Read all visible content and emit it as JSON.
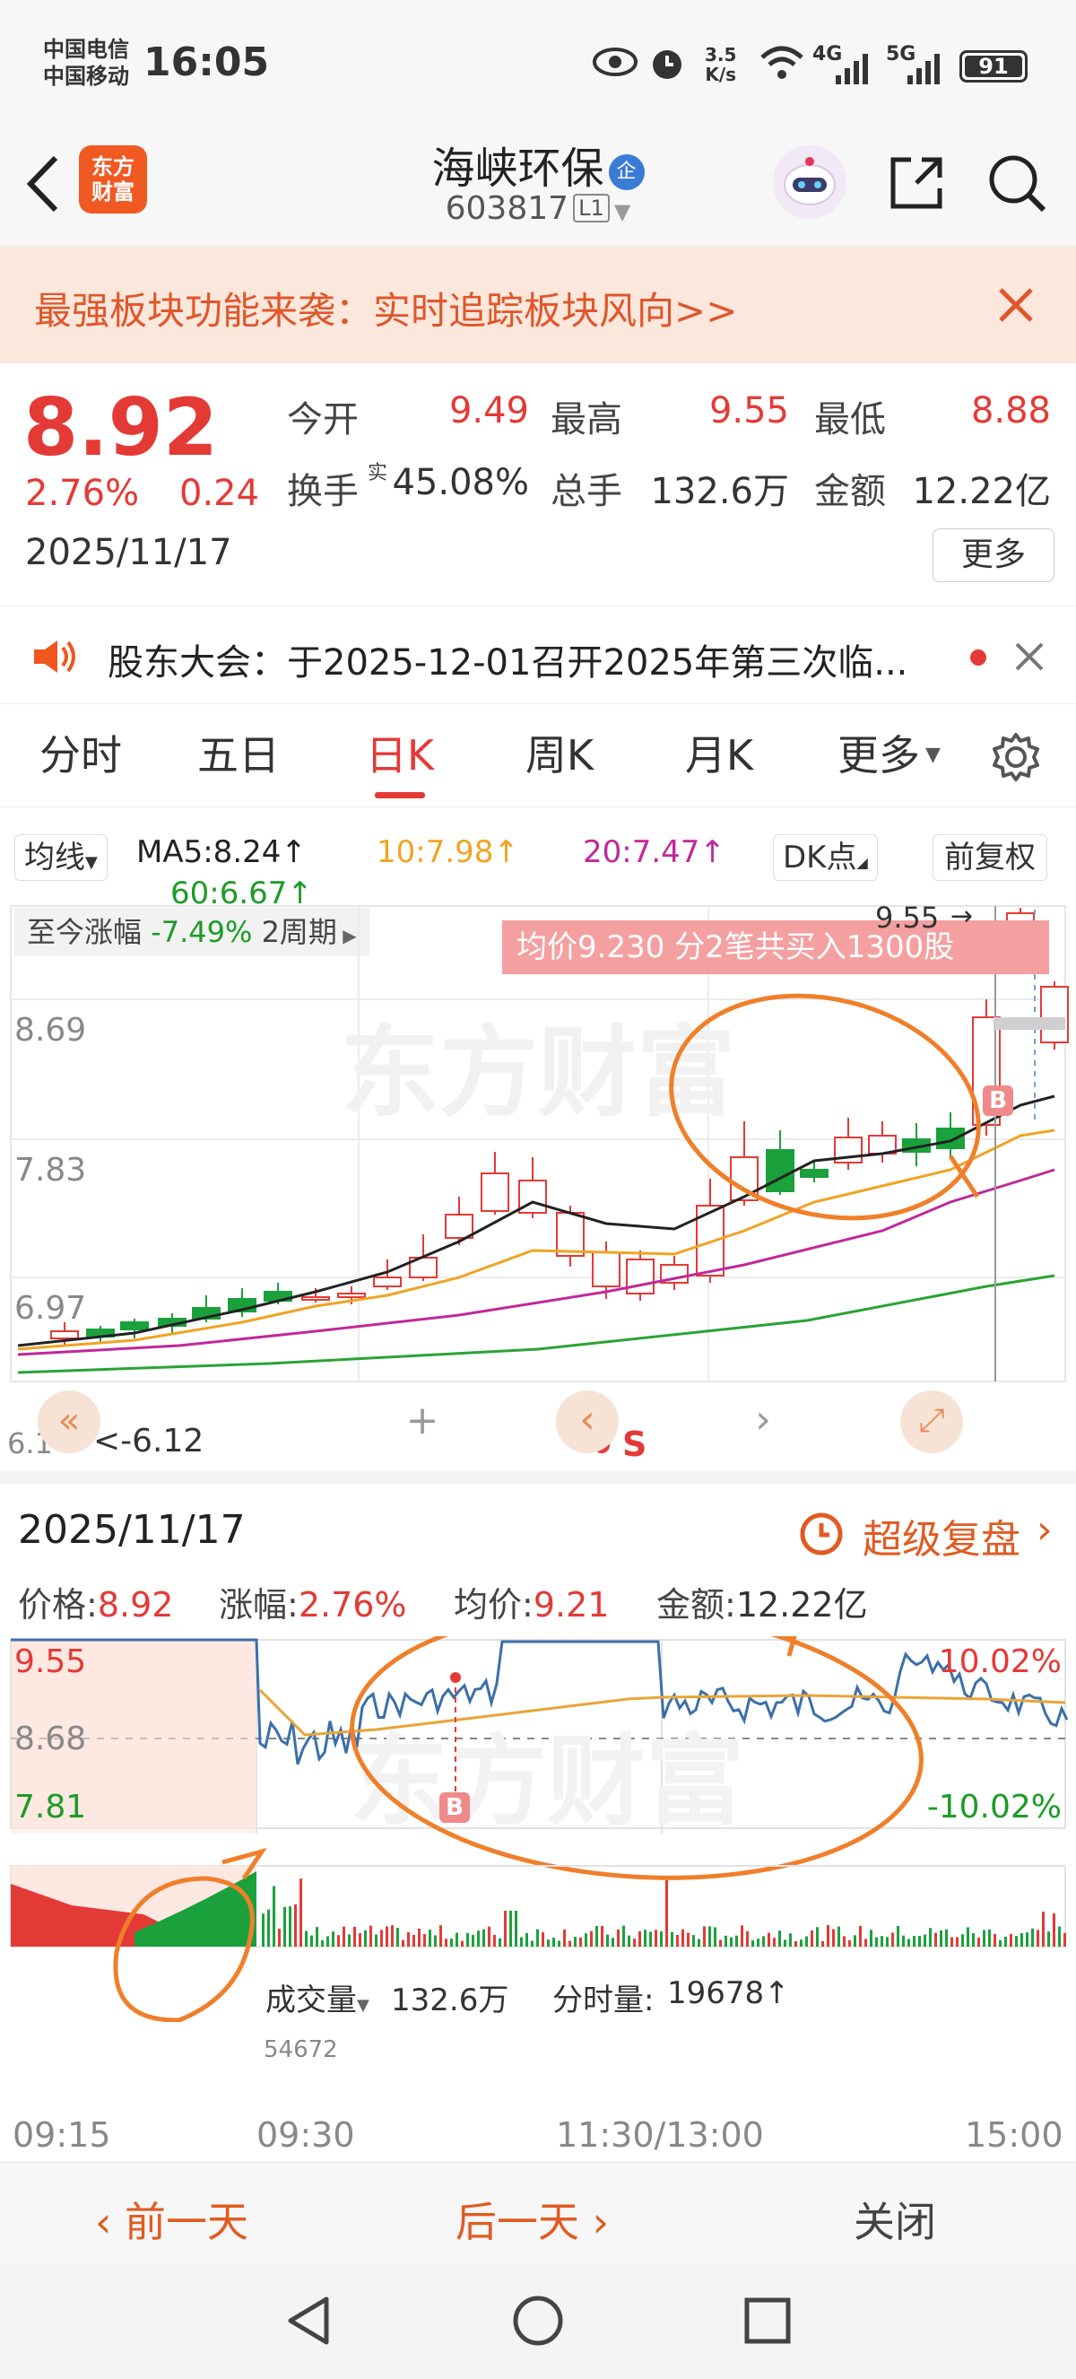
{
  "status_bar": {
    "carrier1": "中国电信",
    "carrier2": "中国移动",
    "time": "16:05",
    "net_speed_top": "3.5",
    "net_speed_unit": "K/s",
    "net1": "4G",
    "net2": "5G",
    "battery": "91"
  },
  "header": {
    "logo_text": "东方财富",
    "stock_name": "海峡环保",
    "badge": "企",
    "stock_code": "603817",
    "level": "L1"
  },
  "banner": {
    "text": "最强板块功能来袭：实时追踪板块风向>>"
  },
  "quote": {
    "price": "8.92",
    "change_pct": "2.76%",
    "change_amt": "0.24",
    "date": "2025/11/17",
    "open_label": "今开",
    "open": "9.49",
    "high_label": "最高",
    "high": "9.55",
    "low_label": "最低",
    "low": "8.88",
    "turnover_label": "换手",
    "turnover_sup": "实",
    "turnover": "45.08%",
    "volume_label": "总手",
    "volume": "132.6万",
    "amount_label": "金额",
    "amount": "12.22亿",
    "more": "更多"
  },
  "notice": {
    "text": "股东大会：于2025-12-01召开2025年第三次临..."
  },
  "tabs": [
    "分时",
    "五日",
    "日K",
    "周K",
    "月K",
    "更多"
  ],
  "active_tab": "日K",
  "kchart": {
    "ma_select": "均线",
    "ma5": "MA5:8.24↑",
    "ma10": "10:7.98↑",
    "ma20": "20:7.47↑",
    "ma60": "60:6.67↑",
    "dk": "DK点",
    "fuquan": "前复权",
    "range_label": "至今涨幅",
    "range_value": "-7.49%",
    "period": "2周期",
    "avg_info": "均价9.230  分2笔共买入1300股",
    "high_mark": "9.55",
    "low_mark": "<-6.12",
    "low_mark_prefix": "6.1",
    "y_labels": [
      "8.69",
      "7.83",
      "6.97"
    ],
    "sell_marker": "S",
    "buy_marker": "B",
    "watermark": "东方财富",
    "colors": {
      "up": "#e43a36",
      "down": "#1aa13c",
      "ma5": "#222222",
      "ma10": "#f0a323",
      "ma20": "#c0289a",
      "ma60": "#2aa334"
    }
  },
  "fenshi": {
    "date": "2025/11/17",
    "replay": "超级复盘",
    "price_label": "价格:",
    "price": "8.92",
    "chg_label": "涨幅:",
    "chg": "2.76%",
    "avg_label": "均价:",
    "avg": "9.21",
    "amt_label": "金额:",
    "amt": "12.22亿",
    "y_top": "9.55",
    "y_mid": "8.68",
    "y_bot": "7.81",
    "pct_top": "10.02%",
    "pct_bot": "-10.02%",
    "vol_select": "成交量",
    "vol_total": "132.6万",
    "vol_tick_label": "分时量:",
    "vol_tick": "19678↑",
    "vol_peak": "54672",
    "times": [
      "09:15",
      "09:30",
      "11:30/13:00",
      "15:00"
    ],
    "buy_marker": "B",
    "watermark": "东方财富"
  },
  "bottom": {
    "prev": "前一天",
    "next": "后一天",
    "close": "关闭"
  }
}
